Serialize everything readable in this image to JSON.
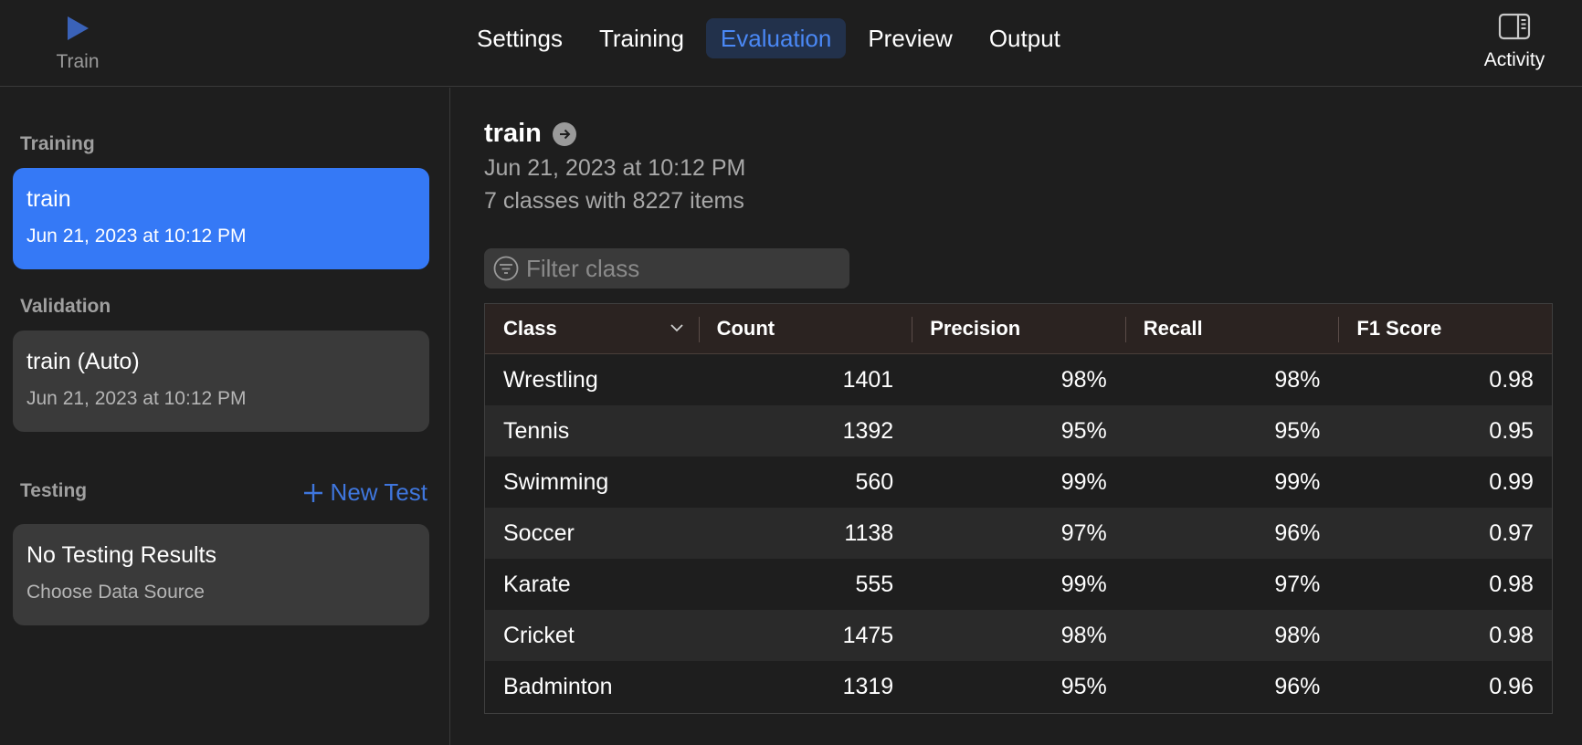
{
  "toolbar": {
    "train_label": "Train",
    "tabs": [
      "Settings",
      "Training",
      "Evaluation",
      "Preview",
      "Output"
    ],
    "active_tab": "Evaluation",
    "activity_label": "Activity"
  },
  "sidebar": {
    "training_label": "Training",
    "training_card": {
      "title": "train",
      "subtitle": "Jun 21, 2023 at 10:12 PM"
    },
    "validation_label": "Validation",
    "validation_card": {
      "title": "train (Auto)",
      "subtitle": "Jun 21, 2023 at 10:12 PM"
    },
    "testing_label": "Testing",
    "new_test_label": "New Test",
    "testing_card": {
      "title": "No Testing Results",
      "subtitle": "Choose Data Source"
    }
  },
  "main": {
    "title": "train",
    "date": "Jun 21, 2023 at 10:12 PM",
    "summary": "7 classes with 8227 items",
    "filter_placeholder": "Filter class",
    "columns": [
      "Class",
      "Count",
      "Precision",
      "Recall",
      "F1 Score"
    ],
    "rows": [
      [
        "Wrestling",
        "1401",
        "98%",
        "98%",
        "0.98"
      ],
      [
        "Tennis",
        "1392",
        "95%",
        "95%",
        "0.95"
      ],
      [
        "Swimming",
        "560",
        "99%",
        "99%",
        "0.99"
      ],
      [
        "Soccer",
        "1138",
        "97%",
        "96%",
        "0.97"
      ],
      [
        "Karate",
        "555",
        "99%",
        "97%",
        "0.98"
      ],
      [
        "Cricket",
        "1475",
        "98%",
        "98%",
        "0.98"
      ],
      [
        "Badminton",
        "1319",
        "95%",
        "96%",
        "0.96"
      ]
    ]
  },
  "colors": {
    "accent": "#3579f6",
    "tab_active_bg": "#22314b",
    "tab_active_text": "#4a88f5",
    "background": "#1e1e1e"
  }
}
